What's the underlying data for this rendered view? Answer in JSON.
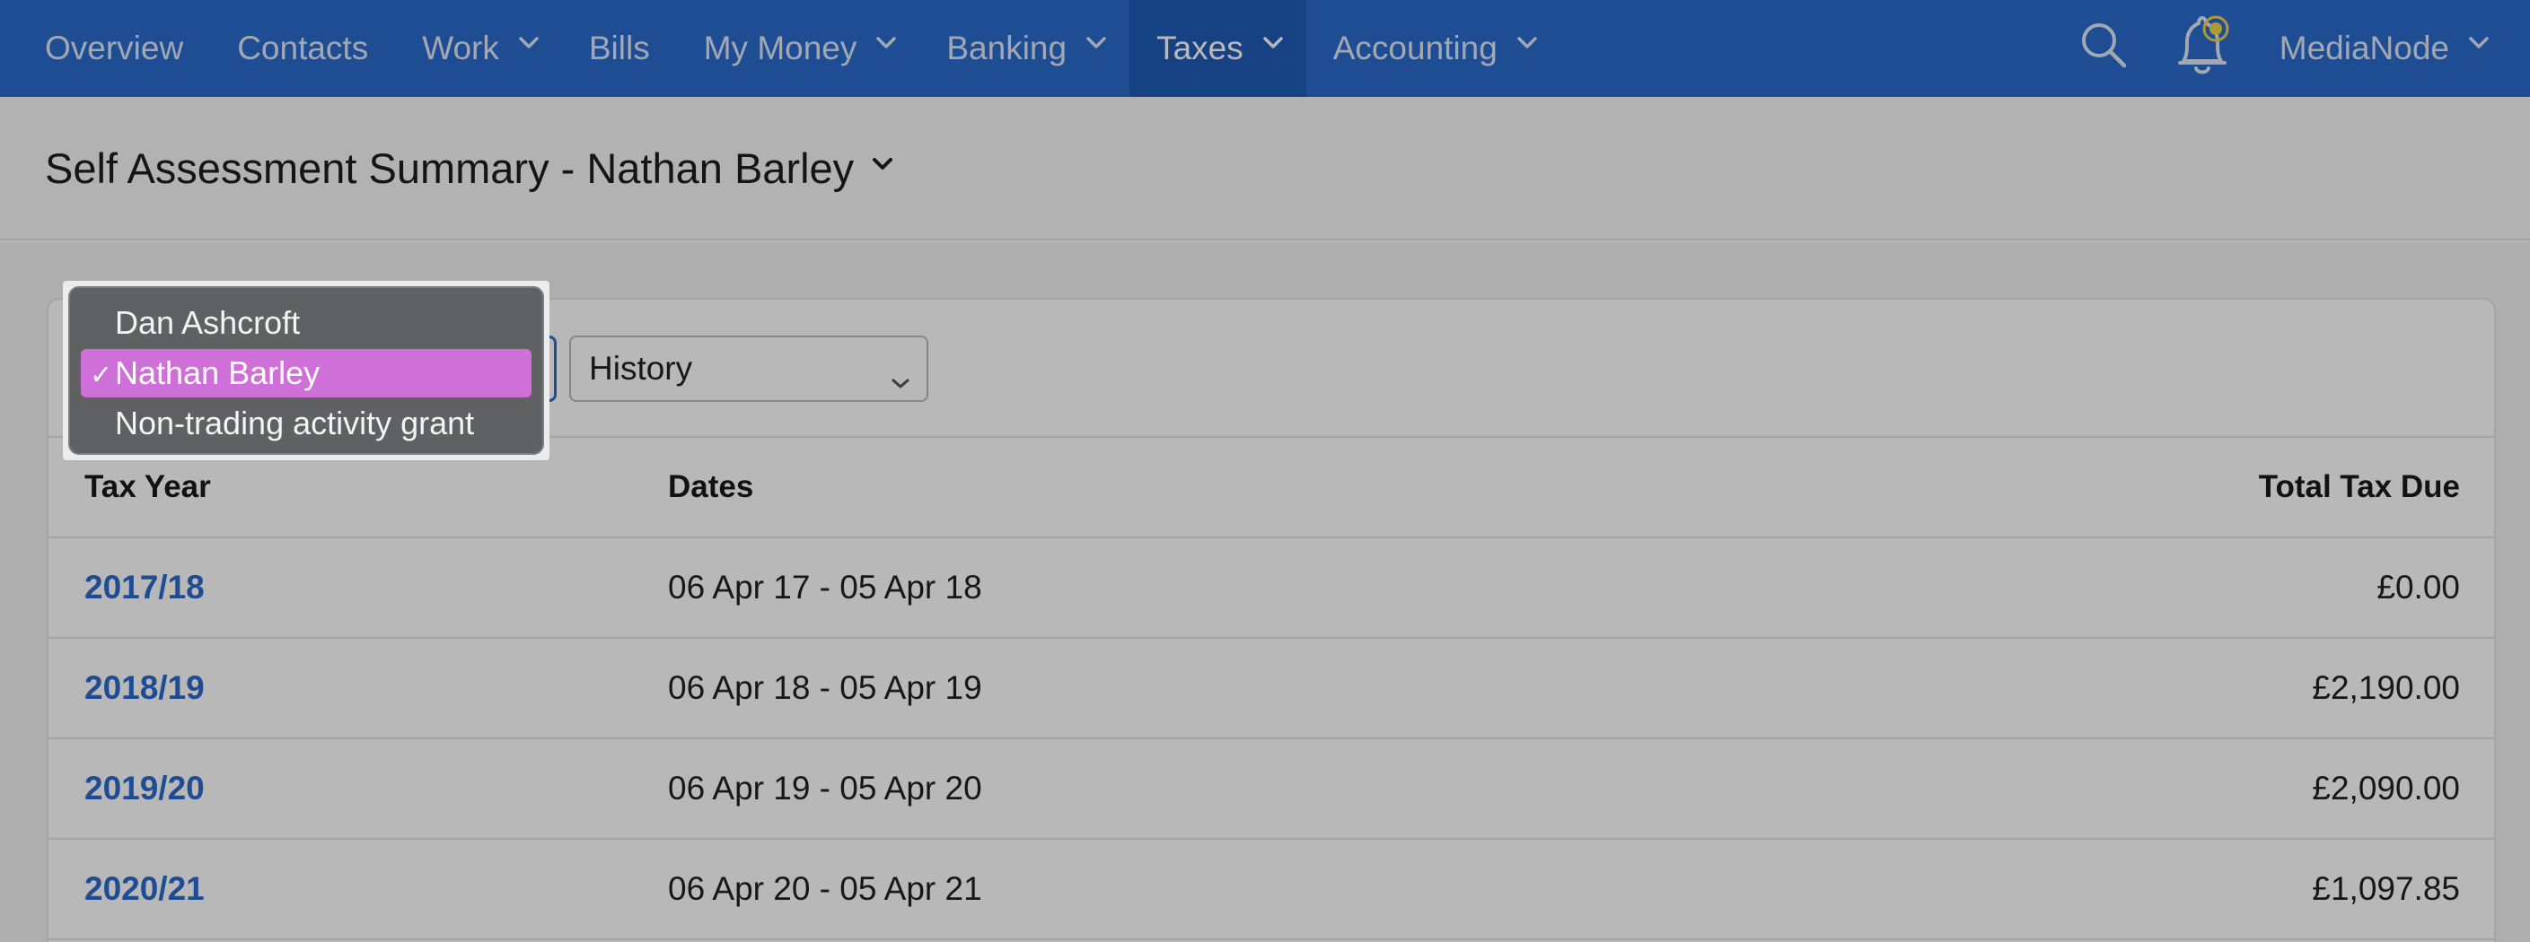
{
  "nav": {
    "items": [
      {
        "label": "Overview",
        "dropdown": false,
        "active": false
      },
      {
        "label": "Contacts",
        "dropdown": false,
        "active": false
      },
      {
        "label": "Work",
        "dropdown": true,
        "active": false
      },
      {
        "label": "Bills",
        "dropdown": false,
        "active": false
      },
      {
        "label": "My Money",
        "dropdown": true,
        "active": false
      },
      {
        "label": "Banking",
        "dropdown": true,
        "active": false
      },
      {
        "label": "Taxes",
        "dropdown": true,
        "active": true
      },
      {
        "label": "Accounting",
        "dropdown": true,
        "active": false
      }
    ],
    "account_label": "MediaNode",
    "icons": {
      "search": "search-icon",
      "notifications": "bell-icon"
    }
  },
  "page": {
    "title": "Self Assessment Summary - Nathan Barley"
  },
  "filters": {
    "person_options": [
      "Dan Ashcroft",
      "Nathan Barley",
      "Non-trading activity grant"
    ],
    "person_selected": "Nathan Barley",
    "view_selected": "History",
    "check_mark": "✓"
  },
  "table": {
    "headers": {
      "tax_year": "Tax Year",
      "dates": "Dates",
      "total": "Total Tax Due"
    },
    "rows": [
      {
        "tax_year": "2017/18",
        "dates": "06 Apr 17 - 05 Apr 18",
        "total": "£0.00"
      },
      {
        "tax_year": "2018/19",
        "dates": "06 Apr 18 - 05 Apr 19",
        "total": "£2,190.00"
      },
      {
        "tax_year": "2019/20",
        "dates": "06 Apr 19 - 05 Apr 20",
        "total": "£2,090.00"
      },
      {
        "tax_year": "2020/21",
        "dates": "06 Apr 20 - 05 Apr 21",
        "total": "£1,097.85"
      }
    ]
  },
  "colors": {
    "nav_bg": "#2a6bcc",
    "link": "#2a6bcc",
    "dropdown_highlight": "#cf6fd8",
    "notification_dot": "#f2d54a"
  }
}
